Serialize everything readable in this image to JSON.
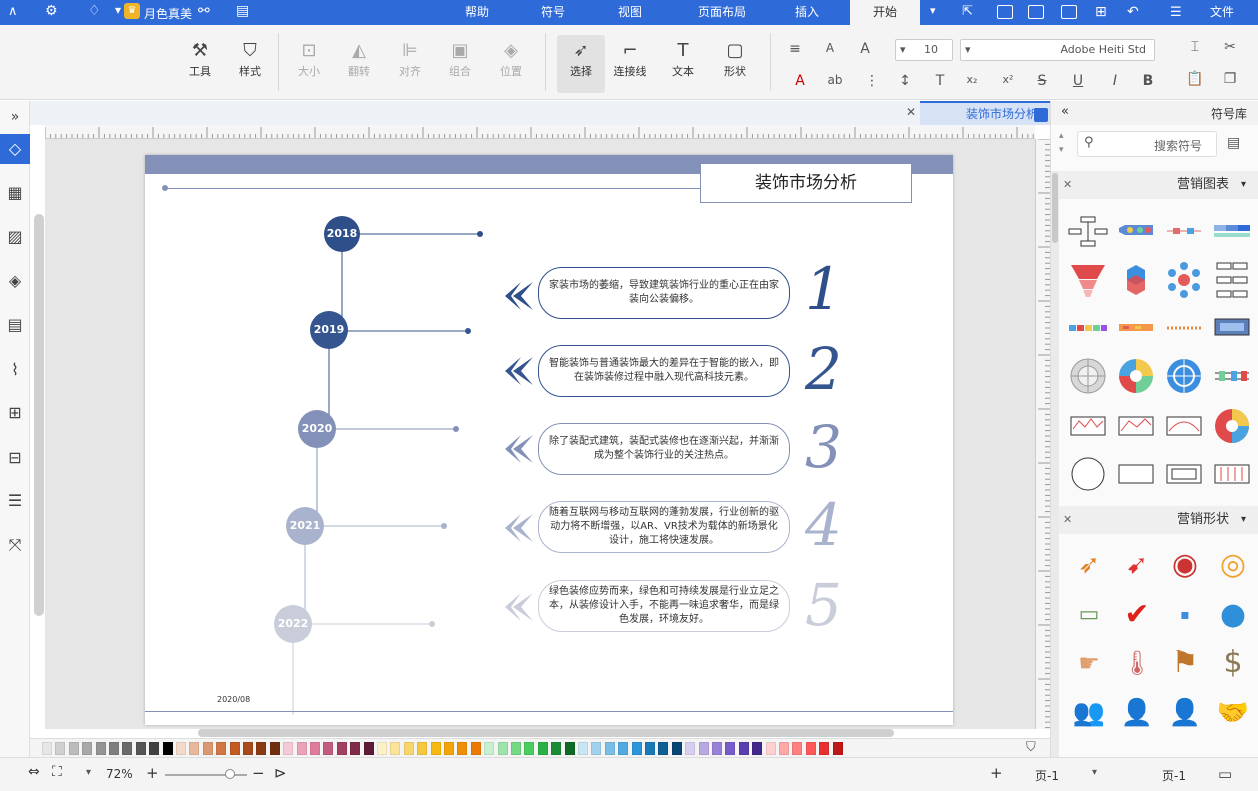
{
  "titlebar": {
    "menus": [
      "文件",
      "开始",
      "插入",
      "页面布局",
      "视图",
      "符号",
      "帮助"
    ],
    "active_menu": "开始",
    "user_name": "月色真美"
  },
  "ribbon": {
    "buttons": {
      "cut": "剪切",
      "paste": "粘贴",
      "font_name": "Adobe Heiti Std",
      "font_size": "10",
      "shape": "形状",
      "text": "文本",
      "connector": "连接线",
      "select": "选择",
      "position": "位置",
      "group": "组合",
      "align": "对齐",
      "flip": "翻转",
      "size": "大小",
      "style": "样式",
      "tools": "工具"
    },
    "glyphs": {
      "bold": "B",
      "italic": "I",
      "underline": "U",
      "strike": "S",
      "font_color": "A",
      "grow_font": "A",
      "shrink_font": "A"
    }
  },
  "document": {
    "tab_title": "装饰市场分析",
    "page_title": "装饰市场分析",
    "date_label": "2020/08",
    "timeline": [
      {
        "year": "2018",
        "num": "1",
        "text": "家装市场的萎缩，导致建筑装饰行业的重心正在由家装向公装偏移。",
        "color": "#2e4f8a",
        "num_color": "#2e4f8a"
      },
      {
        "year": "2019",
        "num": "2",
        "text": "智能装饰与普通装饰最大的差异在于智能的嵌入，即在装饰装修过程中融入现代高科技元素。",
        "color": "#34558f",
        "num_color": "#34558f"
      },
      {
        "year": "2020",
        "num": "3",
        "text": "除了装配式建筑，装配式装修也在逐渐兴起，并渐渐成为整个装饰行业的关注热点。",
        "color": "#8391b8",
        "num_color": "#8391b8"
      },
      {
        "year": "2021",
        "num": "4",
        "text": "随着互联网与移动互联网的蓬勃发展，行业创新的驱动力将不断增强，以AR、VR技术为载体的新场景化设计，施工将快速发展。",
        "color": "#aab3cd",
        "num_color": "#aab3cd"
      },
      {
        "year": "2022",
        "num": "5",
        "text": "绿色装修应势而来，绿色和可持续发展是行业立足之本，从装修设计入手，不能再一味追求奢华，而是绿色发展，环境友好。",
        "color": "#c8cdd9",
        "num_color": "#c8cdd9"
      }
    ]
  },
  "status": {
    "page_label": "页-1",
    "page_tab": "页-1",
    "zoom": "72%"
  },
  "library": {
    "title": "符号库",
    "search_placeholder": "搜索符号",
    "section1": "营销图表",
    "section2": "营销形状"
  },
  "colors": {
    "brand": "#2f6bd8",
    "header_band": "#8391b8",
    "timeline_dark": "#2e4f8a"
  }
}
